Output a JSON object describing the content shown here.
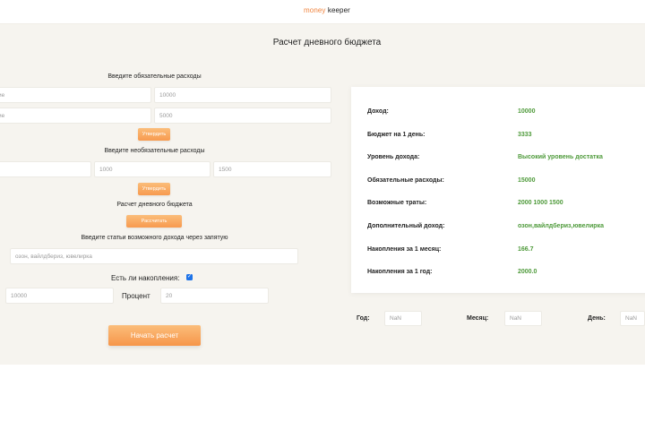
{
  "logo": {
    "part1": "money",
    "part2": " keeper"
  },
  "page_title": "Расчет дневного бюджета",
  "mandatory": {
    "label": "Введите обязательные расходы",
    "rows": [
      {
        "name_placeholder": "ие",
        "amount": "10000"
      },
      {
        "name_placeholder": "ие",
        "amount": "5000"
      }
    ],
    "button": "Утвердить"
  },
  "optional": {
    "label": "Введите необязательные расходы",
    "values": [
      "",
      "1000",
      "1500"
    ],
    "button": "Утвердить"
  },
  "daily": {
    "label": "Расчет дневного бюджета",
    "button": "Рассчитать"
  },
  "income_items": {
    "label": "Введите статьи возможного дохода через запятую",
    "value": "озон, вайлдбериз, ювелирка"
  },
  "savings": {
    "label": "Есть ли накопления:",
    "checked": true,
    "checkmark": "✓",
    "amount": "10000",
    "percent_label": "Процент",
    "percent": "20"
  },
  "start_button": "Начать расчет",
  "results": [
    {
      "key": "Доход:",
      "value": "10000"
    },
    {
      "key": "Бюджет на 1 день:",
      "value": "3333"
    },
    {
      "key": "Уровень дохода:",
      "value": "Высокий уровень достатка"
    },
    {
      "key": "Обязательные расходы:",
      "value": "15000"
    },
    {
      "key": "Возможные траты:",
      "value": "2000 1000 1500"
    },
    {
      "key": "Дополнительный доход:",
      "value": "озон,вайлдбериз,ювелирка"
    },
    {
      "key": "Накопления за 1 месяц:",
      "value": "166.7"
    },
    {
      "key": "Накопления за 1 год:",
      "value": "2000.0"
    }
  ],
  "date": {
    "year_label": "Год:",
    "year_value": "NaN",
    "month_label": "Месяц:",
    "month_value": "NaN",
    "day_label": "День:",
    "day_value": "NaN"
  },
  "colors": {
    "accent": "#f79a4f",
    "result_value": "#4e9a3a",
    "checkbox": "#1e73e8"
  }
}
